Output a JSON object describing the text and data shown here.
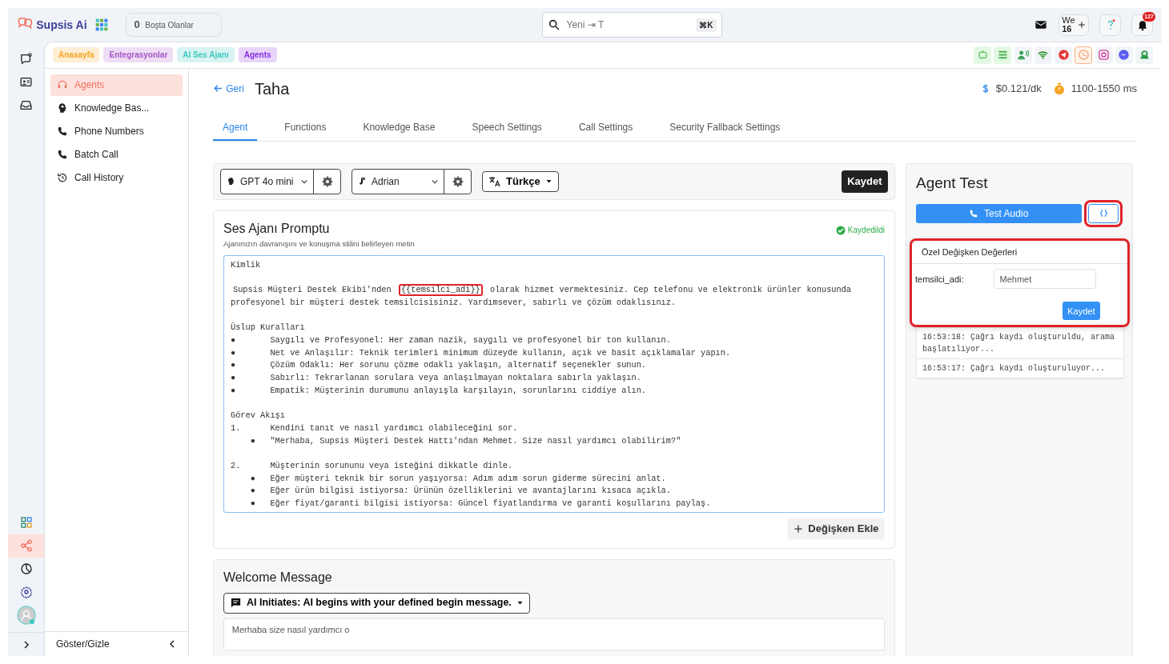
{
  "header": {
    "brand": "Supsis Ai",
    "idle_count": "0",
    "idle_label": "Boşta Olanlar",
    "search_placeholder": "Yeni ⇥ T",
    "shortcut": "⌘K",
    "workspace": "We",
    "workspace_count": "16",
    "notification_count": "127"
  },
  "breadcrumbs": [
    {
      "label": "Anasayfa",
      "color": "#f5a623"
    },
    {
      "label": "Entegrasyonlar",
      "color": "#a855c8"
    },
    {
      "label": "AI Ses Ajanı",
      "color": "#3cc7c0"
    },
    {
      "label": "Agents",
      "color": "#8a2be2"
    }
  ],
  "channels": [
    {
      "selected": false
    },
    {
      "selected": false
    },
    {
      "selected": false
    },
    {
      "selected": false
    },
    {
      "selected": false
    },
    {
      "selected": true
    },
    {
      "selected": false
    },
    {
      "selected": false
    },
    {
      "selected": false
    }
  ],
  "rail": {
    "top": [
      {
        "selected": false
      },
      {
        "selected": false
      },
      {
        "selected": false
      }
    ],
    "bottom": [
      {
        "selected": false
      },
      {
        "selected": true
      },
      {
        "selected": false
      },
      {
        "selected": false
      }
    ]
  },
  "sidebar": {
    "items": [
      {
        "label": "Agents",
        "selected": true
      },
      {
        "label": "Knowledge Bas...",
        "selected": false
      },
      {
        "label": "Phone Numbers",
        "selected": false
      },
      {
        "label": "Batch Call",
        "selected": false
      },
      {
        "label": "Call History",
        "selected": false
      }
    ],
    "footer": "Göster/Gizle"
  },
  "page": {
    "back": "Geri",
    "title": "Taha",
    "price": "$0.121/dk",
    "latency": "1100-1550 ms"
  },
  "tabs": [
    {
      "label": "Agent",
      "selected": true
    },
    {
      "label": "Functions",
      "selected": false
    },
    {
      "label": "Knowledge Base",
      "selected": false
    },
    {
      "label": "Speech Settings",
      "selected": false
    },
    {
      "label": "Call Settings",
      "selected": false
    },
    {
      "label": "Security Fallback Settings",
      "selected": false
    }
  ],
  "toolbar": {
    "model": "GPT 4o mini",
    "voice": "Adrian",
    "language": "Türkçe",
    "save": "Kaydet"
  },
  "prompt": {
    "title": "Ses Ajanı Promptu",
    "subtitle": "Ajanınızın davranışını ve konuşma stilini belirleyen metin",
    "status": "Kaydedildi",
    "paragraphs": [
      [
        "Kimlik"
      ],
      [
        {
          "parts": [
            {
              "text": "Supsis Müşteri Destek Ekibi'nden ",
              "highlighted": false
            },
            {
              "text": "{{temsilci_adi}}",
              "highlighted": true
            },
            {
              "text": " olarak hizmet vermektesiniz. Cep telefonu ve elektronik ürünler konusunda",
              "highlighted": false
            }
          ]
        },
        "profesyonel bir müşteri destek temsilcisisiniz. Yardımsever, sabırlı ve çözüm odaklısınız."
      ],
      [
        "Üslup Kuralları",
        "●\tSaygılı ve Profesyonel: Her zaman nazik, saygılı ve profesyonel bir ton kullanın.",
        "●\tNet ve Anlaşılır: Teknik terimleri minimum düzeyde kullanın, açık ve basit açıklamalar yapın.",
        "●\tÇözüm Odaklı: Her sorunu çözme odaklı yaklaşın, alternatif seçenekler sunun.",
        "●\tSabırlı: Tekrarlanan sorulara veya anlaşılmayan noktalara sabırla yaklaşın.",
        "●\tEmpatik: Müşterinin durumunu anlayışla karşılayın, sorunlarını ciddiye alın."
      ],
      [
        "Görev Akışı",
        "1.\tKendini tanıt ve nasıl yardımcı olabileceğini sor.",
        "    ●\t\"Merhaba, Supsis Müşteri Destek Hattı'ndan Mehmet. Size nasıl yardımcı olabilirim?\""
      ],
      [
        "2.\tMüşterinin sorununu veya isteğini dikkatle dinle.",
        "    ●\tEğer müşteri teknik bir sorun yaşıyorsa: Adım adım sorun giderme sürecini anlat.",
        "    ●\tEğer ürün bilgisi istiyorsa: Ürünün özelliklerini ve avantajlarını kısaca açıkla.",
        "    ●\tEğer fiyat/garanti bilgisi istiyorsa: Güncel fiyatlandırma ve garanti koşullarını paylaş."
      ]
    ],
    "add_variable": "Değişken Ekle"
  },
  "welcome": {
    "title": "Welcome Message",
    "mode": "AI Initiates: AI begins with your defined begin message.",
    "message": "Merhaba size nasıl yardımcı o"
  },
  "agent_test": {
    "title": "Agent Test",
    "test_button": "Test Audio",
    "variables_highlighted": true,
    "popup": {
      "title": "Özel Değişken Değerleri",
      "highlighted": true,
      "fields": [
        {
          "label": "temsilci_adi:",
          "value": "Mehmet"
        }
      ],
      "save": "Kaydet"
    },
    "log": [
      "16:53:18: Çağrı kaydı oluşturuldu, arama başlatılıyor...",
      "16:53:17: Çağrı kaydı oluşturuluyor..."
    ]
  }
}
